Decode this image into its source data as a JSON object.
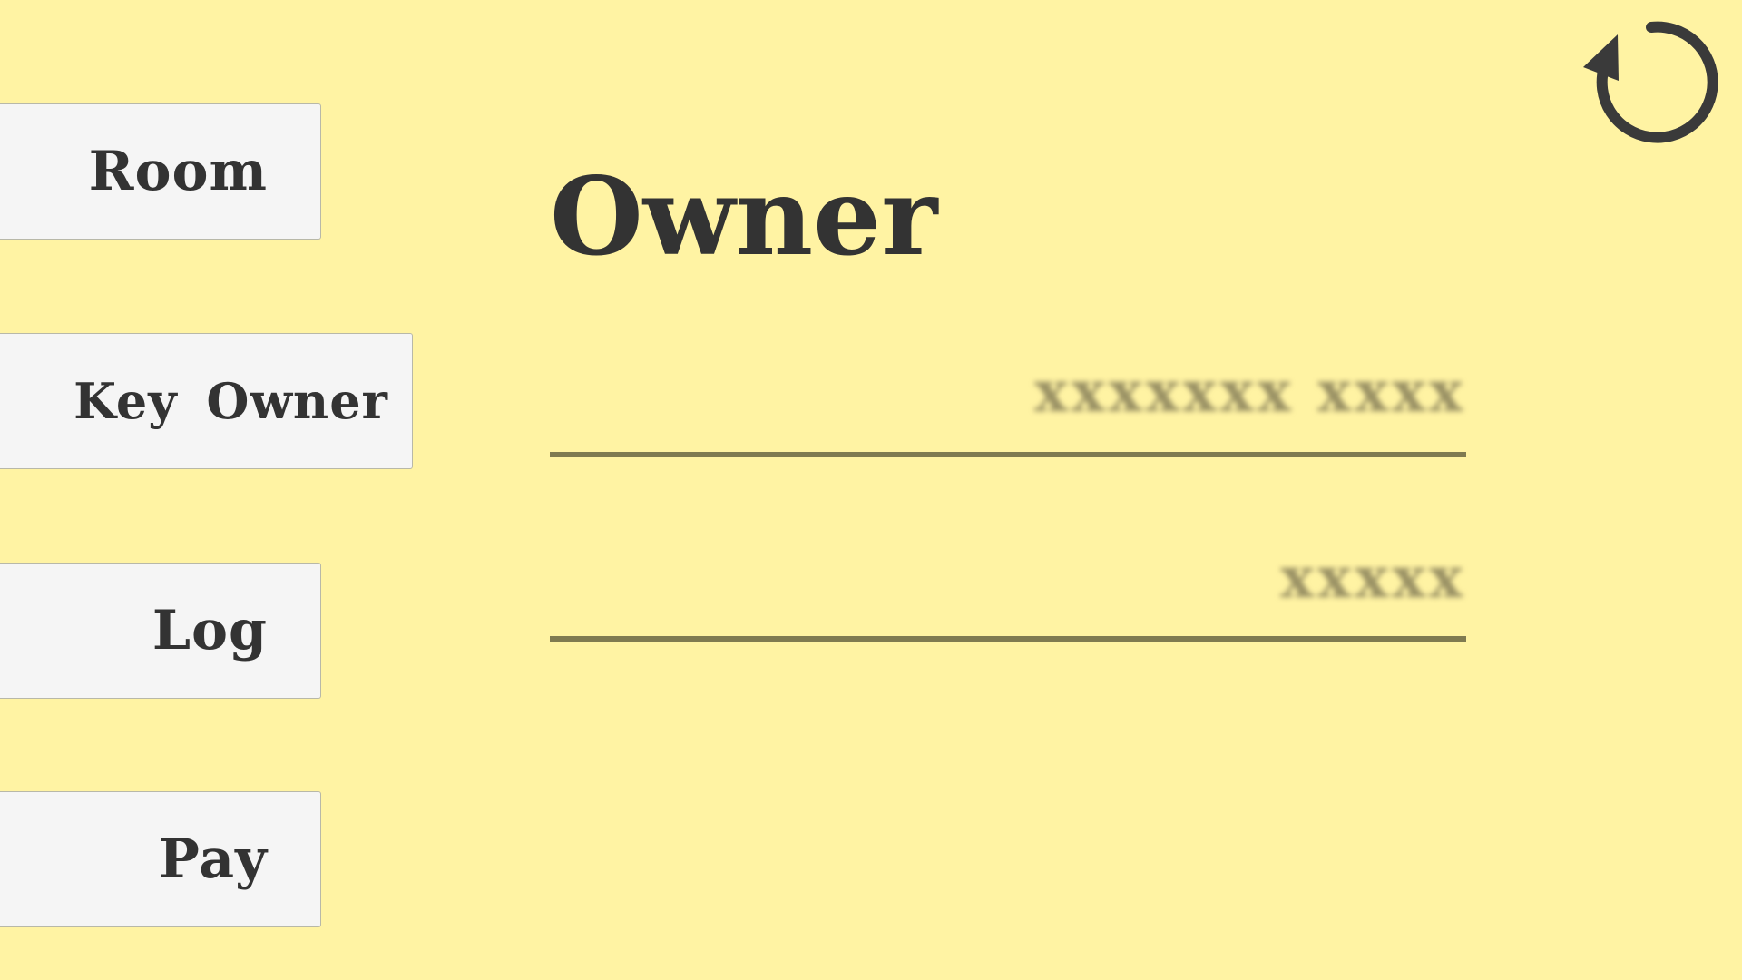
{
  "nav": {
    "room_label": "Room",
    "key_owner_label": "Key Owner",
    "log_label": "Log",
    "pay_label": "Pay"
  },
  "main": {
    "title": "Owner",
    "field_1_value": "xxxxxxx xxxx",
    "field_2_value": "xxxxx"
  },
  "icons": {
    "refresh": "refresh-icon"
  },
  "colors": {
    "background": "#FFF3A3",
    "button_bg": "#F5F5F5",
    "text": "#333333",
    "underline": "#7F7A50"
  }
}
